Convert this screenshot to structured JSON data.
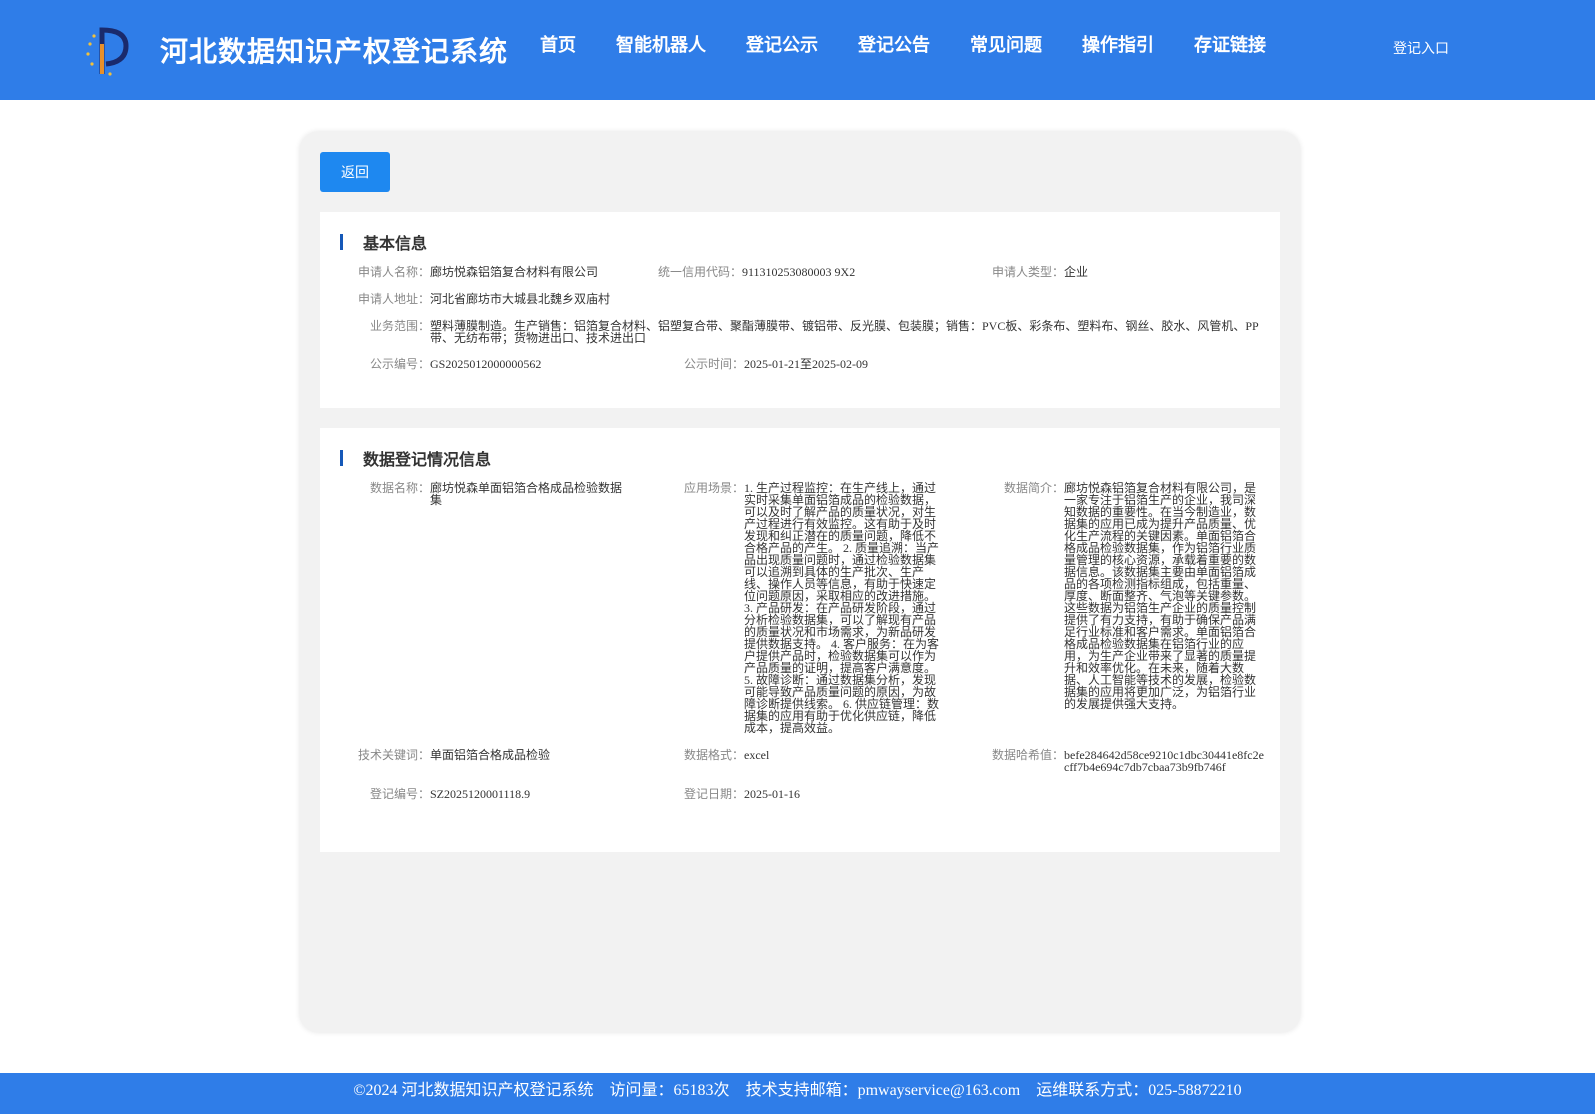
{
  "header": {
    "title": "河北数据知识产权登记系统",
    "nav": [
      "首页",
      "智能机器人",
      "登记公示",
      "登记公告",
      "常见问题",
      "操作指引",
      "存证链接"
    ],
    "login": "登记入口"
  },
  "back_label": "返回",
  "basic": {
    "heading": "基本信息",
    "applicant_name": {
      "label": "申请人名称：",
      "value": "廊坊悦森铝箔复合材料有限公司"
    },
    "credit_code": {
      "label": "统一信用代码：",
      "value": "911310253080003 9X2"
    },
    "applicant_type": {
      "label": "申请人类型：",
      "value": "企业"
    },
    "address": {
      "label": "申请人地址：",
      "value": "河北省廊坊市大城县北魏乡双庙村"
    },
    "scope": {
      "label": "业务范围：",
      "value": "塑料薄膜制造。生产销售：铝箔复合材料、铝塑复合带、聚酯薄膜带、镀铝带、反光膜、包装膜；销售：PVC板、彩条布、塑料布、钢丝、胶水、风管机、PP带、无纺布带；货物进出口、技术进出口"
    },
    "notice_no": {
      "label": "公示编号：",
      "value": "GS2025012000000562"
    },
    "notice_time": {
      "label": "公示时间：",
      "value": "2025-01-21至2025-02-09"
    }
  },
  "data": {
    "heading": "数据登记情况信息",
    "name": {
      "label": "数据名称：",
      "value": "廊坊悦森单面铝箔合格成品检验数据集"
    },
    "scenario": {
      "label": "应用场景：",
      "value": "1. 生产过程监控：在生产线上，通过实时采集单面铝箔成品的检验数据，可以及时了解产品的质量状况，对生产过程进行有效监控。这有助于及时发现和纠正潜在的质量问题，降低不合格产品的产生。 2. 质量追溯：当产品出现质量问题时，通过检验数据集可以追溯到具体的生产批次、生产线、操作人员等信息，有助于快速定位问题原因，采取相应的改进措施。 3. 产品研发：在产品研发阶段，通过分析检验数据集，可以了解现有产品的质量状况和市场需求，为新品研发提供数据支持。 4. 客户服务：在为客户提供产品时，检验数据集可以作为产品质量的证明，提高客户满意度。 5. 故障诊断：通过数据集分析，发现可能导致产品质量问题的原因，为故障诊断提供线索。 6. 供应链管理：数据集的应用有助于优化供应链，降低成本，提高效益。"
    },
    "intro": {
      "label": "数据简介：",
      "value": "廊坊悦森铝箔复合材料有限公司，是一家专注于铝箔生产的企业，我司深知数据的重要性。在当今制造业，数据集的应用已成为提升产品质量、优化生产流程的关键因素。单面铝箔合格成品检验数据集，作为铝箔行业质量管理的核心资源，承载着重要的数据信息。该数据集主要由单面铝箔成品的各项检测指标组成，包括重量、厚度、断面整齐、气泡等关键参数。这些数据为铝箔生产企业的质量控制提供了有力支持，有助于确保产品满足行业标准和客户需求。单面铝箔合格成品检验数据集在铝箔行业的应用，为生产企业带来了显著的质量提升和效率优化。在未来，随着大数据、人工智能等技术的发展，检验数据集的应用将更加广泛，为铝箔行业的发展提供强大支持。"
    },
    "keywords": {
      "label": "技术关键词：",
      "value": "单面铝箔合格成品检验"
    },
    "format": {
      "label": "数据格式：",
      "value": "excel"
    },
    "hash": {
      "label": "数据哈希值：",
      "value": "befe284642d58ce9210c1dbc30441e8fc2ecff7b4e694c7db7cbaa73b9fb746f"
    },
    "reg_no": {
      "label": "登记编号：",
      "value": "SZ2025120001118.9"
    },
    "reg_date": {
      "label": "登记日期：",
      "value": "2025-01-16"
    }
  },
  "footer": {
    "copyright": "©2024 河北数据知识产权登记系统",
    "visits": "访问量：65183次",
    "email": "技术支持邮箱：pmwayservice@163.com",
    "contact": "运维联系方式：025-58872210"
  },
  "colors": {
    "primary": "#2f7de8",
    "button": "#1e88f0",
    "panel": "#f2f2f2",
    "section_bar": "#1558b8"
  }
}
